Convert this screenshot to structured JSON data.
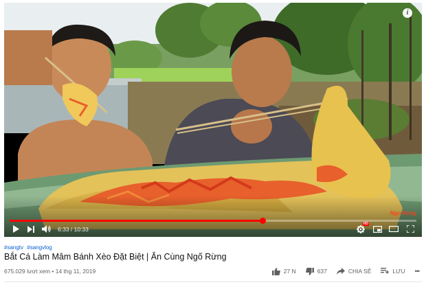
{
  "player": {
    "current_time": "6:33",
    "duration": "10:33",
    "progress": 0.621,
    "info_glyph": "i",
    "watermark": "Ngo Rung",
    "icons": [
      "play-icon",
      "next-icon",
      "volume-icon",
      "settings-icon",
      "miniplayer-icon",
      "theater-icon",
      "fullscreen-icon",
      "info-icon"
    ]
  },
  "video": {
    "hashtags": [
      "#sangtv",
      "#sangvlog"
    ],
    "title": "Bắt Cá Làm Mâm Bánh Xèo Đặt Biệt | Ăn Cùng Ngố Rừng",
    "views_date": "675.029 lượt xem • 14 thg 11, 2019"
  },
  "actions": {
    "like_count": "27 N",
    "dislike_count": "637",
    "share_label": "CHIA SẺ",
    "save_label": "LƯU",
    "more_label": "•••"
  },
  "colors": {
    "progress": "#ff0000",
    "link": "#065fd4",
    "title": "#111111",
    "meta": "#606060"
  }
}
